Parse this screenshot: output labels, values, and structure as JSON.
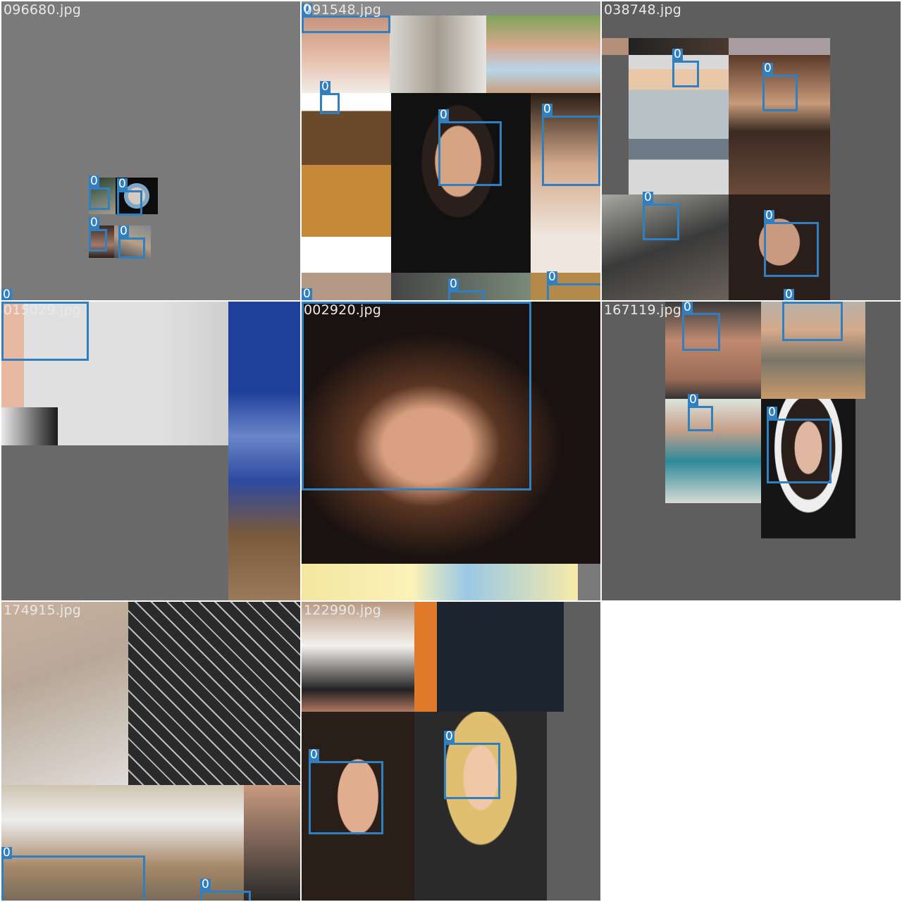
{
  "label": "0",
  "colors": {
    "box": "#2f7fc1",
    "tile_bg": "#7a7a7a",
    "tile_bg_dark": "#5e5e5e",
    "text": "#e9e9e9"
  },
  "tiles": [
    {
      "filename": "096680.jpg"
    },
    {
      "filename": "091548.jpg"
    },
    {
      "filename": "038748.jpg"
    },
    {
      "filename": "015029.jpg"
    },
    {
      "filename": "002920.jpg"
    },
    {
      "filename": "167119.jpg"
    },
    {
      "filename": "174915.jpg"
    },
    {
      "filename": "122990.jpg"
    }
  ]
}
